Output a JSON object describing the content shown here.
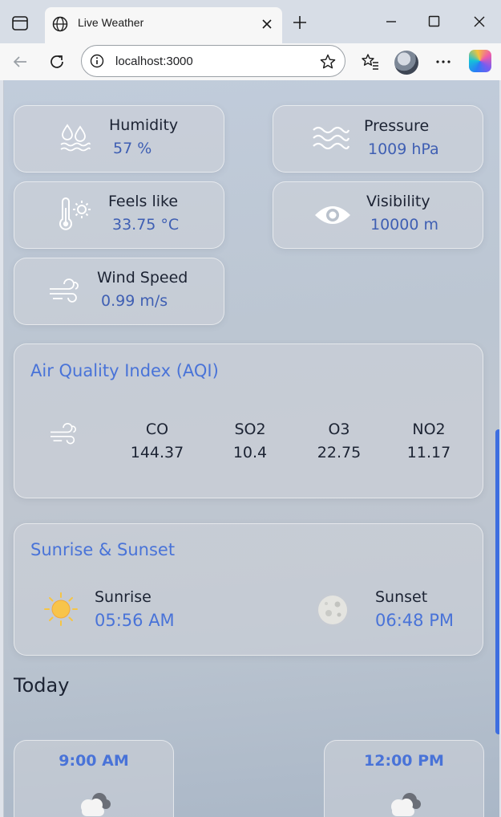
{
  "browser": {
    "tab_title": "Live Weather",
    "address": "localhost:3000"
  },
  "stats": {
    "humidity": {
      "label": "Humidity",
      "value": "57 %"
    },
    "pressure": {
      "label": "Pressure",
      "value": "1009 hPa"
    },
    "feels_like": {
      "label": "Feels like",
      "value": "33.75 °C"
    },
    "visibility": {
      "label": "Visibility",
      "value": "10000 m"
    },
    "wind_speed": {
      "label": "Wind Speed",
      "value": "0.99 m/s"
    }
  },
  "aqi": {
    "title": "Air Quality Index (AQI)",
    "items": [
      {
        "name": "CO",
        "value": "144.37"
      },
      {
        "name": "SO2",
        "value": "10.4"
      },
      {
        "name": "O3",
        "value": "22.75"
      },
      {
        "name": "NO2",
        "value": "11.17"
      }
    ]
  },
  "sun": {
    "title": "Sunrise & Sunset",
    "sunrise_label": "Sunrise",
    "sunrise_time": "05:56 AM",
    "sunset_label": "Sunset",
    "sunset_time": "06:48 PM"
  },
  "today": {
    "title": "Today",
    "forecast": [
      {
        "time": "9:00 AM",
        "icon": "cloud-icon"
      },
      {
        "time": "12:00 PM",
        "icon": "cloud-icon"
      }
    ]
  },
  "colors": {
    "accent": "#4973d8",
    "value_text": "#3f5fb3",
    "scrollbar": "#3d6ee0"
  }
}
